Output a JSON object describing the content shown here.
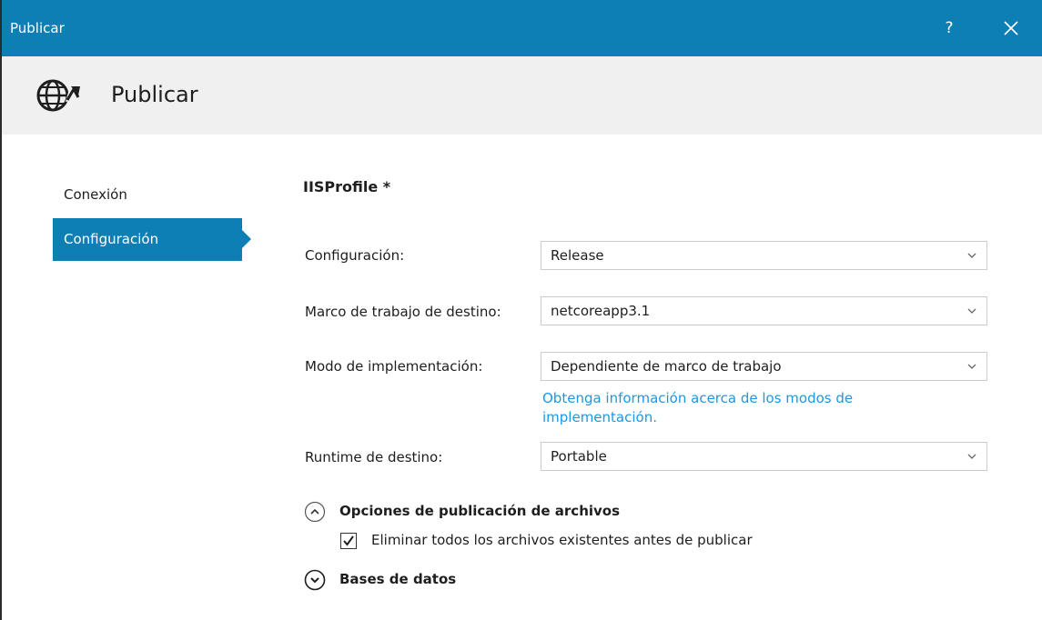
{
  "window": {
    "title": "Publicar",
    "help_label": "?",
    "header_title": "Publicar"
  },
  "sidebar": {
    "items": [
      {
        "label": "Conexión",
        "selected": false
      },
      {
        "label": "Configuración",
        "selected": true
      }
    ]
  },
  "main": {
    "profile_title": "IISProfile *",
    "fields": [
      {
        "label": "Configuración:",
        "value": "Release"
      },
      {
        "label": "Marco de trabajo de destino:",
        "value": "netcoreapp3.1"
      },
      {
        "label": "Modo de implementación:",
        "value": "Dependiente de marco de trabajo"
      },
      {
        "label": "Runtime de destino:",
        "value": "Portable"
      }
    ],
    "info_link": "Obtenga información acerca de los modos de implementación.",
    "sections": [
      {
        "label": "Opciones de publicación de archivos",
        "expanded": true
      },
      {
        "label": "Bases de datos",
        "expanded": false
      }
    ],
    "delete_checkbox": {
      "label": "Eliminar todos los archivos existentes antes de publicar",
      "checked": true
    }
  },
  "colors": {
    "accent": "#0e7fb5",
    "link": "#1b97e6",
    "header_bg": "#f0f0f0"
  },
  "icons": {
    "header": "globe-publish-icon",
    "close": "close-icon",
    "select": "chevron-down-icon",
    "expanded": "chevron-up-circle-icon",
    "collapsed": "chevron-down-circle-icon",
    "checkbox": "checkmark-icon"
  }
}
